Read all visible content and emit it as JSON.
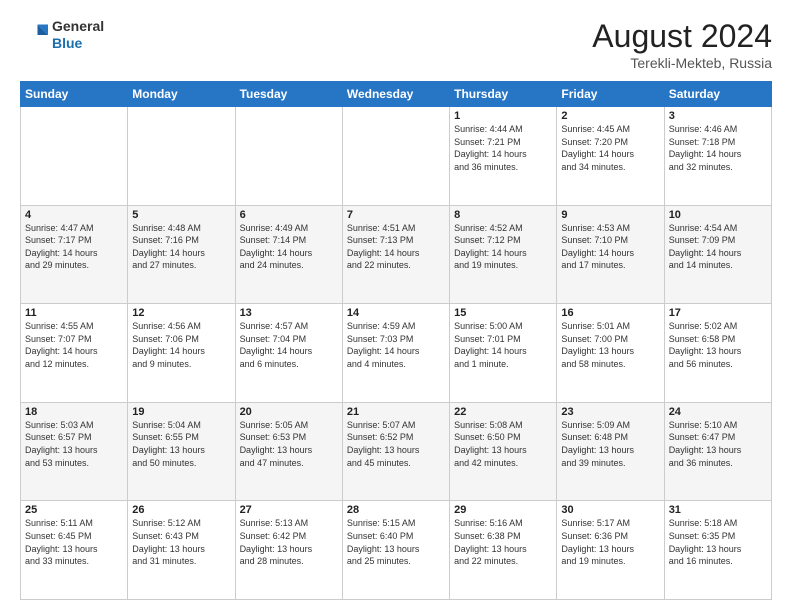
{
  "header": {
    "logo_general": "General",
    "logo_blue": "Blue",
    "month_title": "August 2024",
    "location": "Terekli-Mekteb, Russia"
  },
  "weekdays": [
    "Sunday",
    "Monday",
    "Tuesday",
    "Wednesday",
    "Thursday",
    "Friday",
    "Saturday"
  ],
  "weeks": [
    [
      {
        "day": "",
        "info": ""
      },
      {
        "day": "",
        "info": ""
      },
      {
        "day": "",
        "info": ""
      },
      {
        "day": "",
        "info": ""
      },
      {
        "day": "1",
        "info": "Sunrise: 4:44 AM\nSunset: 7:21 PM\nDaylight: 14 hours\nand 36 minutes."
      },
      {
        "day": "2",
        "info": "Sunrise: 4:45 AM\nSunset: 7:20 PM\nDaylight: 14 hours\nand 34 minutes."
      },
      {
        "day": "3",
        "info": "Sunrise: 4:46 AM\nSunset: 7:18 PM\nDaylight: 14 hours\nand 32 minutes."
      }
    ],
    [
      {
        "day": "4",
        "info": "Sunrise: 4:47 AM\nSunset: 7:17 PM\nDaylight: 14 hours\nand 29 minutes."
      },
      {
        "day": "5",
        "info": "Sunrise: 4:48 AM\nSunset: 7:16 PM\nDaylight: 14 hours\nand 27 minutes."
      },
      {
        "day": "6",
        "info": "Sunrise: 4:49 AM\nSunset: 7:14 PM\nDaylight: 14 hours\nand 24 minutes."
      },
      {
        "day": "7",
        "info": "Sunrise: 4:51 AM\nSunset: 7:13 PM\nDaylight: 14 hours\nand 22 minutes."
      },
      {
        "day": "8",
        "info": "Sunrise: 4:52 AM\nSunset: 7:12 PM\nDaylight: 14 hours\nand 19 minutes."
      },
      {
        "day": "9",
        "info": "Sunrise: 4:53 AM\nSunset: 7:10 PM\nDaylight: 14 hours\nand 17 minutes."
      },
      {
        "day": "10",
        "info": "Sunrise: 4:54 AM\nSunset: 7:09 PM\nDaylight: 14 hours\nand 14 minutes."
      }
    ],
    [
      {
        "day": "11",
        "info": "Sunrise: 4:55 AM\nSunset: 7:07 PM\nDaylight: 14 hours\nand 12 minutes."
      },
      {
        "day": "12",
        "info": "Sunrise: 4:56 AM\nSunset: 7:06 PM\nDaylight: 14 hours\nand 9 minutes."
      },
      {
        "day": "13",
        "info": "Sunrise: 4:57 AM\nSunset: 7:04 PM\nDaylight: 14 hours\nand 6 minutes."
      },
      {
        "day": "14",
        "info": "Sunrise: 4:59 AM\nSunset: 7:03 PM\nDaylight: 14 hours\nand 4 minutes."
      },
      {
        "day": "15",
        "info": "Sunrise: 5:00 AM\nSunset: 7:01 PM\nDaylight: 14 hours\nand 1 minute."
      },
      {
        "day": "16",
        "info": "Sunrise: 5:01 AM\nSunset: 7:00 PM\nDaylight: 13 hours\nand 58 minutes."
      },
      {
        "day": "17",
        "info": "Sunrise: 5:02 AM\nSunset: 6:58 PM\nDaylight: 13 hours\nand 56 minutes."
      }
    ],
    [
      {
        "day": "18",
        "info": "Sunrise: 5:03 AM\nSunset: 6:57 PM\nDaylight: 13 hours\nand 53 minutes."
      },
      {
        "day": "19",
        "info": "Sunrise: 5:04 AM\nSunset: 6:55 PM\nDaylight: 13 hours\nand 50 minutes."
      },
      {
        "day": "20",
        "info": "Sunrise: 5:05 AM\nSunset: 6:53 PM\nDaylight: 13 hours\nand 47 minutes."
      },
      {
        "day": "21",
        "info": "Sunrise: 5:07 AM\nSunset: 6:52 PM\nDaylight: 13 hours\nand 45 minutes."
      },
      {
        "day": "22",
        "info": "Sunrise: 5:08 AM\nSunset: 6:50 PM\nDaylight: 13 hours\nand 42 minutes."
      },
      {
        "day": "23",
        "info": "Sunrise: 5:09 AM\nSunset: 6:48 PM\nDaylight: 13 hours\nand 39 minutes."
      },
      {
        "day": "24",
        "info": "Sunrise: 5:10 AM\nSunset: 6:47 PM\nDaylight: 13 hours\nand 36 minutes."
      }
    ],
    [
      {
        "day": "25",
        "info": "Sunrise: 5:11 AM\nSunset: 6:45 PM\nDaylight: 13 hours\nand 33 minutes."
      },
      {
        "day": "26",
        "info": "Sunrise: 5:12 AM\nSunset: 6:43 PM\nDaylight: 13 hours\nand 31 minutes."
      },
      {
        "day": "27",
        "info": "Sunrise: 5:13 AM\nSunset: 6:42 PM\nDaylight: 13 hours\nand 28 minutes."
      },
      {
        "day": "28",
        "info": "Sunrise: 5:15 AM\nSunset: 6:40 PM\nDaylight: 13 hours\nand 25 minutes."
      },
      {
        "day": "29",
        "info": "Sunrise: 5:16 AM\nSunset: 6:38 PM\nDaylight: 13 hours\nand 22 minutes."
      },
      {
        "day": "30",
        "info": "Sunrise: 5:17 AM\nSunset: 6:36 PM\nDaylight: 13 hours\nand 19 minutes."
      },
      {
        "day": "31",
        "info": "Sunrise: 5:18 AM\nSunset: 6:35 PM\nDaylight: 13 hours\nand 16 minutes."
      }
    ]
  ]
}
